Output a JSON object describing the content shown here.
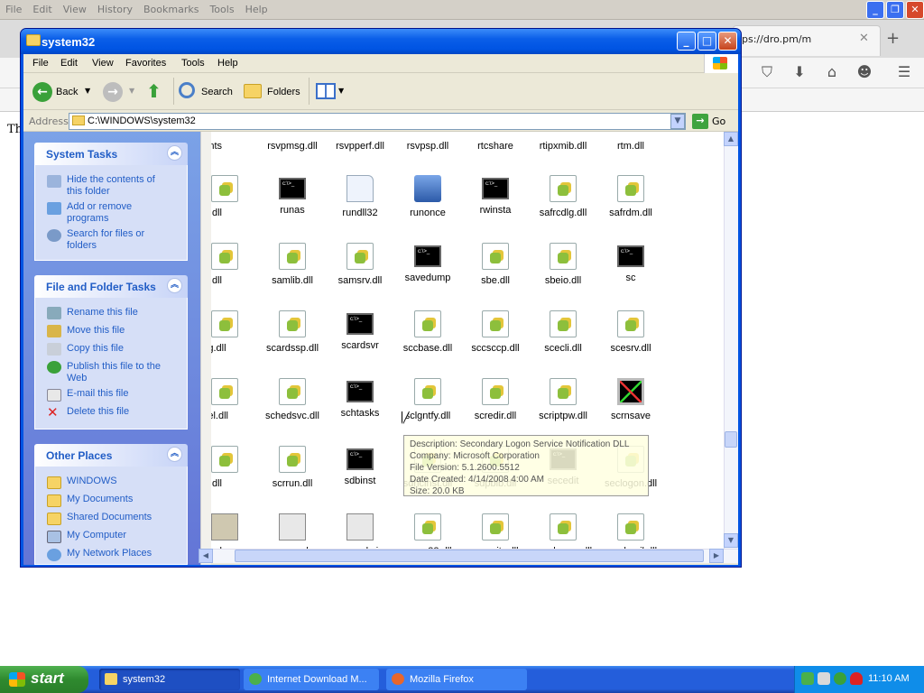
{
  "firefox": {
    "menus": [
      "File",
      "Edit",
      "View",
      "History",
      "Bookmarks",
      "Tools",
      "Help"
    ],
    "tab_url": "ps://dro.pm/m",
    "page_text": "Th"
  },
  "explorer": {
    "title": "system32",
    "menus": [
      "File",
      "Edit",
      "View",
      "Favorites",
      "Tools",
      "Help"
    ],
    "toolbar": {
      "back": "Back",
      "search": "Search",
      "folders": "Folders"
    },
    "address_label": "Address",
    "address_value": "C:\\WINDOWS\\system32",
    "go_label": "Go",
    "system_tasks": {
      "title": "System Tasks",
      "items": [
        "Hide the contents of this folder",
        "Add or remove programs",
        "Search for files or folders"
      ]
    },
    "file_tasks": {
      "title": "File and Folder Tasks",
      "items": [
        "Rename this file",
        "Move this file",
        "Copy this file",
        "Publish this file to the Web",
        "E-mail this file",
        "Delete this file"
      ]
    },
    "other_places": {
      "title": "Other Places",
      "items": [
        "WINDOWS",
        "My Documents",
        "Shared Documents",
        "My Computer",
        "My Network Places"
      ]
    },
    "files": [
      [
        "vpcnts",
        "rsvpmsg.dll",
        "rsvpperf.dll",
        "rsvpsp.dll",
        "rtcshare",
        "rtipxmib.dll",
        "rtm.dll"
      ],
      [
        "utils.dll",
        "runas",
        "rundll32",
        "runonce",
        "rwinsta",
        "safrcdlg.dll",
        "safrdm.dll"
      ],
      [
        "rslv.dll",
        "samlib.dll",
        "samsrv.dll",
        "savedump",
        "sbe.dll",
        "sbeio.dll",
        "sc"
      ],
      [
        "rddlg.dll",
        "scardssp.dll",
        "scardsvr",
        "sccbase.dll",
        "sccsccp.dll",
        "scecli.dll",
        "scesrv.dll"
      ],
      [
        "annel.dll",
        "schedsvc.dll",
        "schtasks",
        "sclgntfy.dll",
        "scredir.dll",
        "scriptpw.dll",
        "scrnsave"
      ],
      [
        "robj.dll",
        "scrrun.dll",
        "sdbinst",
        "sdhcinst.dll",
        "sdpblb.dll",
        "secedit",
        "seclogon.dll"
      ],
      [
        "acpol",
        "secupd",
        "secupd.sig",
        "secur32.dll",
        "security.dll",
        "sendcmsg.dll",
        "sendmail.dll"
      ]
    ],
    "tooltip": {
      "description": "Description: Secondary Logon Service Notification DLL",
      "company": "Company: Microsoft Corporation",
      "version": "File Version: 5.1.2600.5512",
      "created": "Date Created: 4/14/2008 4:00 AM",
      "size": "Size: 20.0 KB"
    }
  },
  "taskbar": {
    "start": "start",
    "tasks": [
      "system32",
      "Internet Download M...",
      "Mozilla Firefox"
    ],
    "clock": "11:10 AM"
  }
}
